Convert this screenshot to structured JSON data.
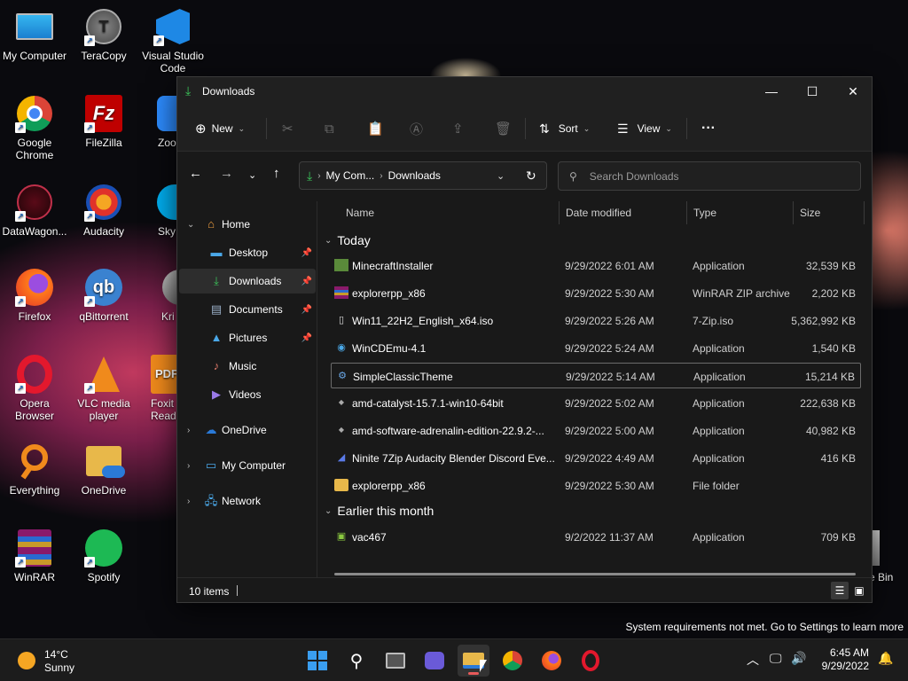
{
  "desktop": {
    "icons": [
      {
        "label": "My Computer"
      },
      {
        "label": "TeraCopy"
      },
      {
        "label": "Visual Studio Code"
      },
      {
        "label": "Google Chrome"
      },
      {
        "label": "FileZilla"
      },
      {
        "label": "Zoo"
      },
      {
        "label": "DataWagon..."
      },
      {
        "label": "Audacity"
      },
      {
        "label": "Sky"
      },
      {
        "label": "Firefox"
      },
      {
        "label": "qBittorrent"
      },
      {
        "label": "Kri"
      },
      {
        "label": "Opera Browser"
      },
      {
        "label": "VLC media player"
      },
      {
        "label": "Foxit Read"
      },
      {
        "label": "Everything"
      },
      {
        "label": "OneDrive"
      },
      {
        "label": "WinRAR"
      },
      {
        "label": "Spotify"
      },
      {
        "label": "e Bin"
      }
    ],
    "watermark": "System requirements not met. Go to Settings to learn more"
  },
  "window": {
    "title": "Downloads",
    "buttons": {
      "minimize": "—",
      "maximize": "☐",
      "close": "✕"
    },
    "toolbar": {
      "new_label": "New",
      "sort_label": "Sort",
      "view_label": "View",
      "more_label": "···"
    },
    "address": {
      "crumbs": [
        "My Com...",
        "Downloads"
      ]
    },
    "search": {
      "placeholder": "Search Downloads"
    },
    "sidebar": [
      {
        "label": "Home"
      },
      {
        "label": "Desktop"
      },
      {
        "label": "Downloads"
      },
      {
        "label": "Documents"
      },
      {
        "label": "Pictures"
      },
      {
        "label": "Music"
      },
      {
        "label": "Videos"
      },
      {
        "label": "OneDrive"
      },
      {
        "label": "My Computer"
      },
      {
        "label": "Network"
      }
    ],
    "columns": {
      "name": "Name",
      "date": "Date modified",
      "type": "Type",
      "size": "Size"
    },
    "groups": {
      "today": "Today",
      "earlier": "Earlier this month"
    },
    "files": [
      {
        "name": "MinecraftInstaller",
        "date": "9/29/2022 6:01 AM",
        "type": "Application",
        "size": "32,539 KB"
      },
      {
        "name": "explorerpp_x86",
        "date": "9/29/2022 5:30 AM",
        "type": "WinRAR ZIP archive",
        "size": "2,202 KB"
      },
      {
        "name": "Win11_22H2_English_x64.iso",
        "date": "9/29/2022 5:26 AM",
        "type": "7-Zip.iso",
        "size": "5,362,992 KB"
      },
      {
        "name": "WinCDEmu-4.1",
        "date": "9/29/2022 5:24 AM",
        "type": "Application",
        "size": "1,540 KB"
      },
      {
        "name": "SimpleClassicTheme",
        "date": "9/29/2022 5:14 AM",
        "type": "Application",
        "size": "15,214 KB"
      },
      {
        "name": "amd-catalyst-15.7.1-win10-64bit",
        "date": "9/29/2022 5:02 AM",
        "type": "Application",
        "size": "222,638 KB"
      },
      {
        "name": "amd-software-adrenalin-edition-22.9.2-...",
        "date": "9/29/2022 5:00 AM",
        "type": "Application",
        "size": "40,982 KB"
      },
      {
        "name": "Ninite 7Zip Audacity Blender Discord Eve...",
        "date": "9/29/2022 4:49 AM",
        "type": "Application",
        "size": "416 KB"
      },
      {
        "name": "explorerpp_x86",
        "date": "9/29/2022 5:30 AM",
        "type": "File folder",
        "size": ""
      },
      {
        "name": "vac467",
        "date": "9/2/2022 11:37 AM",
        "type": "Application",
        "size": "709 KB"
      }
    ],
    "status": {
      "count": "10 items"
    }
  },
  "taskbar": {
    "weather": {
      "temp": "14°C",
      "cond": "Sunny"
    },
    "clock": {
      "time": "6:45 AM",
      "date": "9/29/2022"
    }
  },
  "colors": {
    "accent": "#3bc45a",
    "window_bg": "#191919",
    "taskbar_bg": "#1c1c1c"
  }
}
